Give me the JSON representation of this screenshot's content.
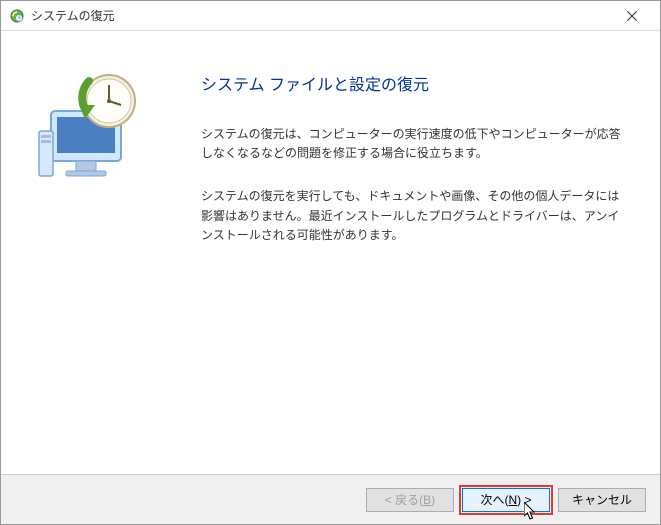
{
  "titlebar": {
    "title": "システムの復元"
  },
  "main": {
    "heading": "システム ファイルと設定の復元",
    "paragraph1": "システムの復元は、コンピューターの実行速度の低下やコンピューターが応答しなくなるなどの問題を修正する場合に役立ちます。",
    "paragraph2": "システムの復元を実行しても、ドキュメントや画像、その他の個人データには影響はありません。最近インストールしたプログラムとドライバーは、アンインストールされる可能性があります。"
  },
  "footer": {
    "back_prefix": "< 戻る(",
    "back_key": "B",
    "back_suffix": ")",
    "next_prefix": "次へ(",
    "next_key": "N",
    "next_suffix": ") >",
    "cancel": "キャンセル"
  }
}
